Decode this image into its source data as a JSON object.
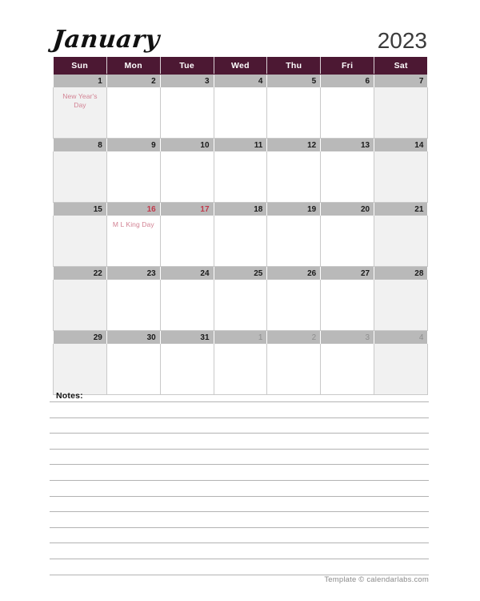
{
  "header": {
    "month": "January",
    "year": "2023"
  },
  "colors": {
    "header_bar": "#4c1833",
    "daynum_bar": "#b9b9b9",
    "weekend_cell": "#f1f1f1",
    "weekday_cell": "#ffffff",
    "holiday_text": "#d28293",
    "holiday_number": "#c0394b",
    "muted_number": "#8e8e8e",
    "grid_border": "#c9c9c9",
    "notes_line": "#b3b3b3",
    "footer_text": "#8a8a8a"
  },
  "weekdays": [
    "Sun",
    "Mon",
    "Tue",
    "Wed",
    "Thu",
    "Fri",
    "Sat"
  ],
  "weeks": [
    [
      {
        "num": "1",
        "muted": false,
        "holiday_num": false,
        "weekend": true,
        "event": "New Year's Day"
      },
      {
        "num": "2",
        "muted": false,
        "holiday_num": false,
        "weekend": false,
        "event": ""
      },
      {
        "num": "3",
        "muted": false,
        "holiday_num": false,
        "weekend": false,
        "event": ""
      },
      {
        "num": "4",
        "muted": false,
        "holiday_num": false,
        "weekend": false,
        "event": ""
      },
      {
        "num": "5",
        "muted": false,
        "holiday_num": false,
        "weekend": false,
        "event": ""
      },
      {
        "num": "6",
        "muted": false,
        "holiday_num": false,
        "weekend": false,
        "event": ""
      },
      {
        "num": "7",
        "muted": false,
        "holiday_num": false,
        "weekend": true,
        "event": ""
      }
    ],
    [
      {
        "num": "8",
        "muted": false,
        "holiday_num": false,
        "weekend": true,
        "event": ""
      },
      {
        "num": "9",
        "muted": false,
        "holiday_num": false,
        "weekend": false,
        "event": ""
      },
      {
        "num": "10",
        "muted": false,
        "holiday_num": false,
        "weekend": false,
        "event": ""
      },
      {
        "num": "11",
        "muted": false,
        "holiday_num": false,
        "weekend": false,
        "event": ""
      },
      {
        "num": "12",
        "muted": false,
        "holiday_num": false,
        "weekend": false,
        "event": ""
      },
      {
        "num": "13",
        "muted": false,
        "holiday_num": false,
        "weekend": false,
        "event": ""
      },
      {
        "num": "14",
        "muted": false,
        "holiday_num": false,
        "weekend": true,
        "event": ""
      }
    ],
    [
      {
        "num": "15",
        "muted": false,
        "holiday_num": false,
        "weekend": true,
        "event": ""
      },
      {
        "num": "16",
        "muted": false,
        "holiday_num": true,
        "weekend": false,
        "event": "M L King Day"
      },
      {
        "num": "17",
        "muted": false,
        "holiday_num": true,
        "weekend": false,
        "event": ""
      },
      {
        "num": "18",
        "muted": false,
        "holiday_num": false,
        "weekend": false,
        "event": ""
      },
      {
        "num": "19",
        "muted": false,
        "holiday_num": false,
        "weekend": false,
        "event": ""
      },
      {
        "num": "20",
        "muted": false,
        "holiday_num": false,
        "weekend": false,
        "event": ""
      },
      {
        "num": "21",
        "muted": false,
        "holiday_num": false,
        "weekend": true,
        "event": ""
      }
    ],
    [
      {
        "num": "22",
        "muted": false,
        "holiday_num": false,
        "weekend": true,
        "event": ""
      },
      {
        "num": "23",
        "muted": false,
        "holiday_num": false,
        "weekend": false,
        "event": ""
      },
      {
        "num": "24",
        "muted": false,
        "holiday_num": false,
        "weekend": false,
        "event": ""
      },
      {
        "num": "25",
        "muted": false,
        "holiday_num": false,
        "weekend": false,
        "event": ""
      },
      {
        "num": "26",
        "muted": false,
        "holiday_num": false,
        "weekend": false,
        "event": ""
      },
      {
        "num": "27",
        "muted": false,
        "holiday_num": false,
        "weekend": false,
        "event": ""
      },
      {
        "num": "28",
        "muted": false,
        "holiday_num": false,
        "weekend": true,
        "event": ""
      }
    ],
    [
      {
        "num": "29",
        "muted": false,
        "holiday_num": false,
        "weekend": true,
        "event": ""
      },
      {
        "num": "30",
        "muted": false,
        "holiday_num": false,
        "weekend": false,
        "event": ""
      },
      {
        "num": "31",
        "muted": false,
        "holiday_num": false,
        "weekend": false,
        "event": ""
      },
      {
        "num": "1",
        "muted": true,
        "holiday_num": false,
        "weekend": false,
        "event": ""
      },
      {
        "num": "2",
        "muted": true,
        "holiday_num": false,
        "weekend": false,
        "event": ""
      },
      {
        "num": "3",
        "muted": true,
        "holiday_num": false,
        "weekend": false,
        "event": ""
      },
      {
        "num": "4",
        "muted": true,
        "holiday_num": false,
        "weekend": true,
        "event": ""
      }
    ]
  ],
  "notes": {
    "label": "Notes:",
    "line_count": 12
  },
  "footer": {
    "text": "Template © calendarlabs.com"
  }
}
